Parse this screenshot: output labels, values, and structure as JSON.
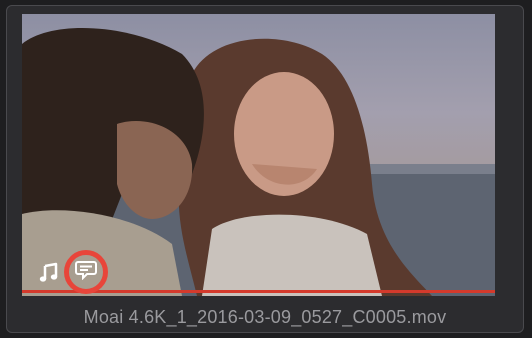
{
  "clip": {
    "filename": "Moai 4.6K_1_2016-03-09_0527_C0005.mov"
  },
  "icons": {
    "audio": "music-note-icon",
    "subtitle": "subtitle-caption-icon"
  },
  "colors": {
    "highlight_ring": "#e8453a",
    "progress_line": "#d43a2c",
    "filename_text": "#9a9a9e"
  }
}
